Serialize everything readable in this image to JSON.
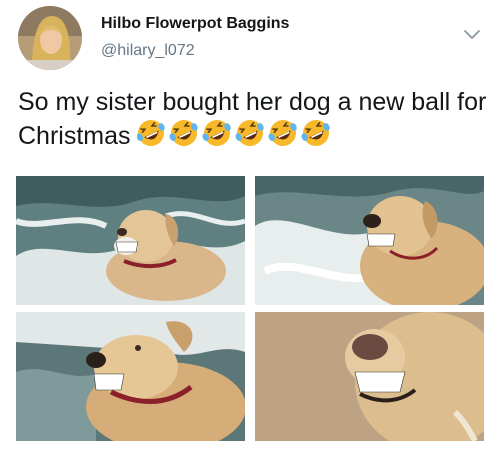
{
  "tweet": {
    "author": {
      "display_name": "Hilbo Flowerpot Baggins",
      "handle": "@hilary_l072",
      "avatar_icon": "profile-photo"
    },
    "menu_icon": "chevron-down-icon",
    "text": "So my sister bought her dog a new ball for Christmas",
    "emoji": {
      "name": "rolling-on-the-floor-laughing-emoji",
      "count": 6
    },
    "photos": [
      {
        "name": "dog-in-surf-grinning"
      },
      {
        "name": "dog-in-waves-grinning"
      },
      {
        "name": "dog-closeup-grinning"
      },
      {
        "name": "dog-on-sand-grinning-closeup"
      }
    ]
  },
  "colors": {
    "text": "#14171a",
    "secondary": "#657786",
    "emoji_face": "#f7b829"
  }
}
